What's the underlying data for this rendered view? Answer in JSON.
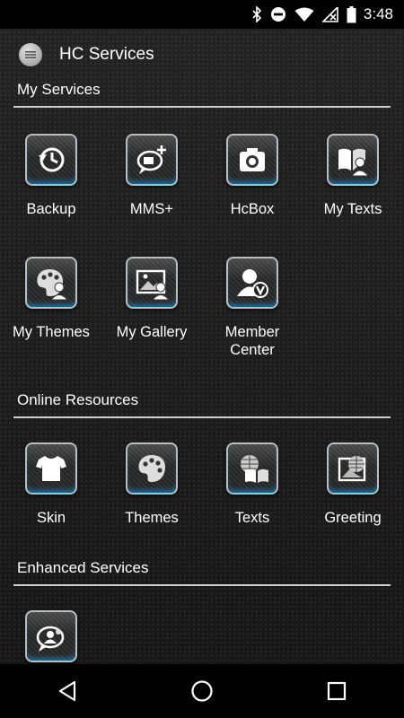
{
  "status_bar": {
    "time": "3:48",
    "icons": [
      "bluetooth-icon",
      "do-not-disturb-icon",
      "wifi-icon",
      "no-signal-icon",
      "battery-icon"
    ]
  },
  "app_bar": {
    "title": "HC Services",
    "menu_icon": "menu-icon"
  },
  "sections": {
    "my_services": {
      "title": "My Services",
      "items": [
        {
          "label": "Backup",
          "icon": "backup-clock-icon"
        },
        {
          "label": "MMS+",
          "icon": "mms-chat-icon"
        },
        {
          "label": "HcBox",
          "icon": "camera-box-icon"
        },
        {
          "label": "My Texts",
          "icon": "book-person-icon"
        },
        {
          "label": "My Themes",
          "icon": "palette-person-icon"
        },
        {
          "label": "My Gallery",
          "icon": "image-person-icon"
        },
        {
          "label": "Member\nCenter",
          "icon": "member-badge-icon"
        }
      ]
    },
    "online_resources": {
      "title": "Online Resources",
      "items": [
        {
          "label": "Skin",
          "icon": "tshirt-icon"
        },
        {
          "label": "Themes",
          "icon": "palette-icon"
        },
        {
          "label": "Texts",
          "icon": "globe-book-icon"
        },
        {
          "label": "Greeting",
          "icon": "globe-card-icon"
        }
      ]
    },
    "enhanced_services": {
      "title": "Enhanced Services",
      "items": [
        {
          "label": "",
          "icon": "chat-person-icon"
        }
      ]
    }
  },
  "nav_bar": {
    "buttons": [
      "back-icon",
      "home-icon",
      "recents-icon"
    ]
  },
  "colors": {
    "accent_glow": "#00aaff",
    "divider": "#cfcfcf",
    "status_bar_bg": "#000000",
    "background": "#1c1c1c"
  }
}
